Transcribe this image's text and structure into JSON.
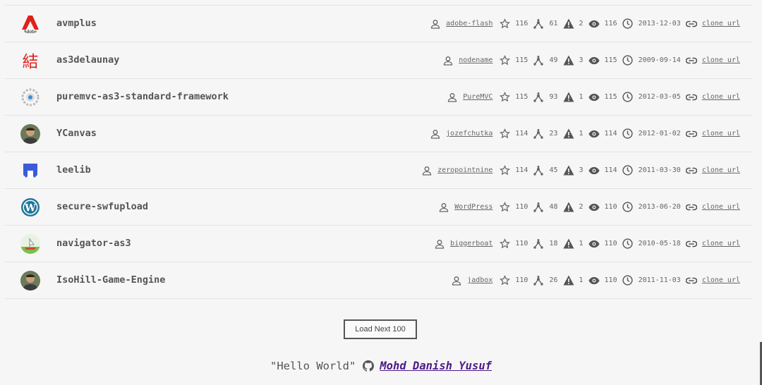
{
  "repos": [
    {
      "name": "avmplus",
      "owner": "adobe-flash",
      "stars": "116",
      "forks": "61",
      "issues": "2",
      "watchers": "116",
      "date": "2013-12-03",
      "clone": "clone url",
      "avatar": "adobe-icon"
    },
    {
      "name": "as3delaunay",
      "owner": "nodename",
      "stars": "115",
      "forks": "49",
      "issues": "3",
      "watchers": "115",
      "date": "2009-09-14",
      "clone": "clone url",
      "avatar": "kanji-icon"
    },
    {
      "name": "puremvc-as3-standard-framework",
      "owner": "PureMVC",
      "stars": "115",
      "forks": "93",
      "issues": "1",
      "watchers": "115",
      "date": "2012-03-05",
      "clone": "clone url",
      "avatar": "puremvc-icon"
    },
    {
      "name": "YCanvas",
      "owner": "jozefchutka",
      "stars": "114",
      "forks": "23",
      "issues": "1",
      "watchers": "114",
      "date": "2012-01-02",
      "clone": "clone url",
      "avatar": "user-photo-icon"
    },
    {
      "name": "leelib",
      "owner": "zeropointnine",
      "stars": "114",
      "forks": "45",
      "issues": "3",
      "watchers": "114",
      "date": "2011-03-30",
      "clone": "clone url",
      "avatar": "leelib-icon"
    },
    {
      "name": "secure-swfupload",
      "owner": "WordPress",
      "stars": "110",
      "forks": "48",
      "issues": "2",
      "watchers": "110",
      "date": "2013-06-20",
      "clone": "clone url",
      "avatar": "wordpress-icon"
    },
    {
      "name": "navigator-as3",
      "owner": "biggerboat",
      "stars": "110",
      "forks": "18",
      "issues": "1",
      "watchers": "110",
      "date": "2010-05-18",
      "clone": "clone url",
      "avatar": "boat-icon"
    },
    {
      "name": "IsoHill-Game-Engine",
      "owner": "jadbox",
      "stars": "110",
      "forks": "26",
      "issues": "1",
      "watchers": "110",
      "date": "2011-11-03",
      "clone": "clone url",
      "avatar": "user-photo-icon"
    }
  ],
  "load_button": "Load Next 100",
  "footer": {
    "quote": "\"Hello World\"",
    "author": "Mohd Danish Yusuf"
  },
  "colors": {
    "accent": "#4b1b8a",
    "adobe_red": "#e0201b",
    "wordpress_blue": "#21759b",
    "leelib_blue": "#3b5bdb"
  }
}
